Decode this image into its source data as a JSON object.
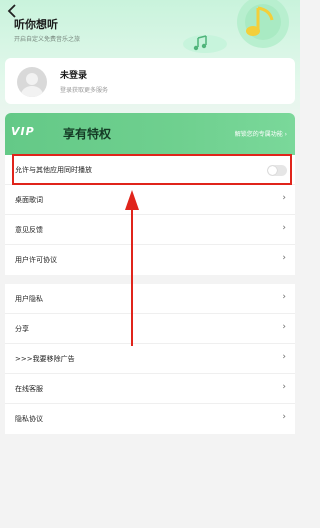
{
  "header": {
    "back_icon": "chevron-left-icon",
    "title": "听你想听",
    "subtitle": "开启自定义免费音乐之旅"
  },
  "login": {
    "title": "未登录",
    "subtitle": "登录获取更多服务",
    "avatar_icon": "avatar-placeholder-icon"
  },
  "vip": {
    "tag": "VIP",
    "title": "享有特权",
    "link": "解锁您的专属功能 ›"
  },
  "group1": [
    {
      "label": "允许与其他应用同时播放",
      "type": "toggle",
      "on": false
    },
    {
      "label": "桌面歌词",
      "type": "link"
    },
    {
      "label": "意见反馈",
      "type": "link"
    },
    {
      "label": "用户许可协议",
      "type": "link"
    }
  ],
  "group2": [
    {
      "label": "用户隐私",
      "type": "link"
    },
    {
      "label": "分享",
      "type": "link"
    },
    {
      "label": ">>>我要移除广告",
      "type": "link"
    },
    {
      "label": "在线客服",
      "type": "link"
    },
    {
      "label": "隐私协议",
      "type": "link"
    }
  ],
  "annotation": {
    "highlight_color": "#e0241b",
    "arrow_color": "#e0241b"
  },
  "colors": {
    "accent": "#6fd08f",
    "header_bg": "#c9f3dc"
  }
}
